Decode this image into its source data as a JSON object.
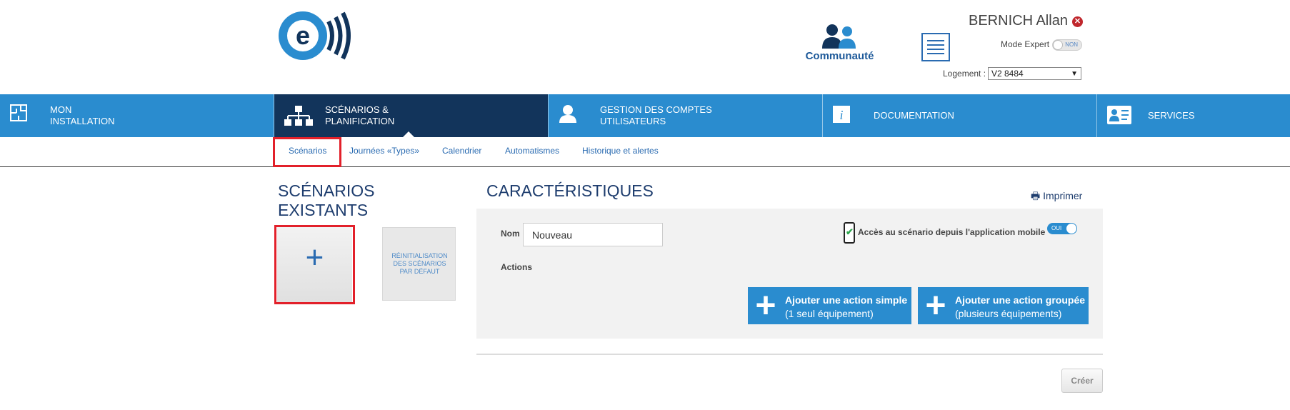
{
  "header": {
    "community_label": "Communauté",
    "user_name": "BERNICH Allan",
    "mode_label": "Mode Expert",
    "mode_toggle_text": "NON",
    "logement_label": "Logement :",
    "logement_value": "V2 8484"
  },
  "nav": {
    "items": [
      {
        "label": "MON\nINSTALLATION",
        "icon": "floorplan-icon"
      },
      {
        "label": "SCÉNARIOS &\nPLANIFICATION",
        "icon": "network-icon"
      },
      {
        "label": "GESTION DES COMPTES\nUTILISATEURS",
        "icon": "user-icon"
      },
      {
        "label": "DOCUMENTATION",
        "icon": "info-icon"
      },
      {
        "label": "SERVICES",
        "icon": "id-card-icon"
      }
    ]
  },
  "subnav": {
    "items": [
      "Scénarios",
      "Journées «Types»",
      "Calendrier",
      "Automatismes",
      "Historique et alertes"
    ]
  },
  "left": {
    "title": "SCÉNARIOS\nEXISTANTS",
    "add_symbol": "+",
    "reset_label": "RÉINITIALISATION DES SCÉNARIOS PAR DÉFAUT"
  },
  "main": {
    "title": "CARACTÉRISTIQUES",
    "print_label": "Imprimer",
    "nom_label": "Nom",
    "nom_value": "Nouveau",
    "mobile_label": "Accès au scénario depuis l'application mobile",
    "mobile_toggle_text": "OUI",
    "actions_label": "Actions",
    "action_simple_title": "Ajouter une action simple",
    "action_simple_sub": "(1 seul équipement)",
    "action_group_title": "Ajouter une action groupée",
    "action_group_sub": "(plusieurs équipements)",
    "create_label": "Créer"
  },
  "colors": {
    "nav_blue": "#2a8ccf",
    "nav_active": "#12345b",
    "highlight_red": "#e2202a",
    "title_navy": "#1e3d6e"
  }
}
